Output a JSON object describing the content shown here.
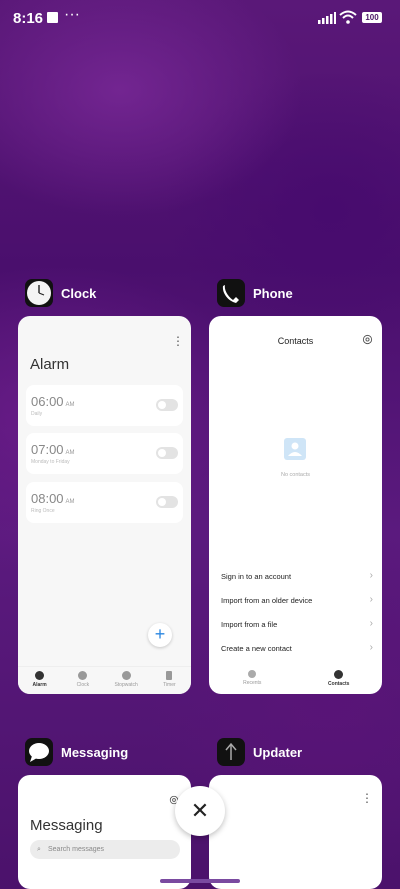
{
  "status_bar": {
    "time": "8:16",
    "dots": "···",
    "battery": "100"
  },
  "apps": {
    "clock": {
      "name": "Clock",
      "title": "Alarm",
      "alarms": [
        {
          "time": "06:00",
          "ampm": "AM",
          "sub": "Daily"
        },
        {
          "time": "07:00",
          "ampm": "AM",
          "sub": "Monday to Friday"
        },
        {
          "time": "08:00",
          "ampm": "AM",
          "sub": "Ring Once"
        }
      ],
      "fab": "+",
      "nav": [
        "Alarm",
        "Clock",
        "Stopwatch",
        "Timer"
      ]
    },
    "phone": {
      "name": "Phone",
      "title": "Contacts",
      "empty_text": "No contacts",
      "actions": [
        "Sign in to an account",
        "Import from an older device",
        "Import from a file",
        "Create a new contact"
      ],
      "nav": [
        "Recents",
        "Contacts"
      ]
    },
    "messaging": {
      "name": "Messaging",
      "title": "Messaging",
      "search_placeholder": "Search messages"
    },
    "updater": {
      "name": "Updater"
    }
  },
  "close_button": "✕",
  "colors": {
    "wallpaper": "#4a0f6d",
    "accent_blue": "#2a86e0",
    "card": "#f7f7f7"
  }
}
